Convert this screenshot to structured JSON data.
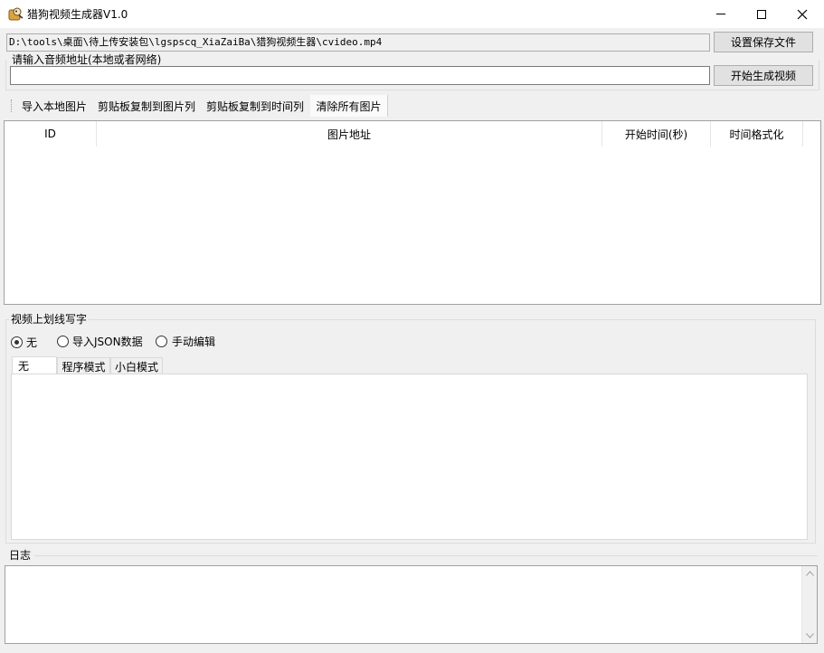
{
  "window": {
    "title": "猎狗视频生成器V1.0",
    "controls": {
      "minimize": "minimize-icon",
      "maximize": "maximize-icon",
      "close": "close-icon"
    }
  },
  "save_path": {
    "value": "D:\\tools\\桌面\\待上传安装包\\lgspscq_XiaZaiBa\\猎狗视频生器\\cvideo.mp4",
    "button_label": "设置保存文件"
  },
  "audio": {
    "label": "请输入音频地址(本地或者网络)",
    "value": "",
    "button_label": "开始生成视频"
  },
  "toolbar": {
    "items": [
      "导入本地图片",
      "剪贴板复制到图片列",
      "剪贴板复制到时间列",
      "清除所有图片"
    ]
  },
  "image_table": {
    "columns": [
      "ID",
      "图片地址",
      "开始时间(秒)",
      "时间格式化"
    ],
    "rows": []
  },
  "overlay_text": {
    "group_label": "视频上划线写字",
    "options": [
      "无",
      "导入JSON数据",
      "手动编辑"
    ],
    "selected_option": "无",
    "tabs": [
      "无",
      "程序模式",
      "小白模式"
    ],
    "selected_tab": "无"
  },
  "log": {
    "label": "日志",
    "content": ""
  }
}
